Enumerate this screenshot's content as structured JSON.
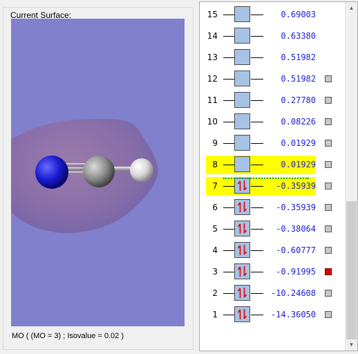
{
  "surface_panel": {
    "title": "Current Surface:",
    "caption": "MO ( (MO = 3) ; Isovalue = 0.02 )"
  },
  "mo_levels": [
    {
      "n": "15",
      "energy": "0.69003",
      "occupied": false,
      "highlight": false,
      "has_square": false
    },
    {
      "n": "14",
      "energy": "0.63380",
      "occupied": false,
      "highlight": false,
      "has_square": false
    },
    {
      "n": "13",
      "energy": "0.51982",
      "occupied": false,
      "highlight": false,
      "has_square": false
    },
    {
      "n": "12",
      "energy": "0.51982",
      "occupied": false,
      "highlight": false,
      "has_square": true,
      "active": false
    },
    {
      "n": "11",
      "energy": "0.27780",
      "occupied": false,
      "highlight": false,
      "has_square": true,
      "active": false
    },
    {
      "n": "10",
      "energy": "0.08226",
      "occupied": false,
      "highlight": false,
      "has_square": true,
      "active": false
    },
    {
      "n": "9",
      "energy": "0.01929",
      "occupied": false,
      "highlight": false,
      "has_square": true,
      "active": false
    },
    {
      "n": "8",
      "energy": "0.01929",
      "occupied": false,
      "highlight": true,
      "has_square": true,
      "active": false
    },
    {
      "n": "7",
      "energy": "-0.35939",
      "occupied": true,
      "highlight": true,
      "has_square": true,
      "active": false
    },
    {
      "n": "6",
      "energy": "-0.35939",
      "occupied": true,
      "highlight": false,
      "has_square": true,
      "active": false
    },
    {
      "n": "5",
      "energy": "-0.38064",
      "occupied": true,
      "highlight": false,
      "has_square": true,
      "active": false
    },
    {
      "n": "4",
      "energy": "-0.60777",
      "occupied": true,
      "highlight": false,
      "has_square": true,
      "active": false
    },
    {
      "n": "3",
      "energy": "-0.91995",
      "occupied": true,
      "highlight": false,
      "has_square": true,
      "active": true
    },
    {
      "n": "2",
      "energy": "-10.24608",
      "occupied": true,
      "highlight": false,
      "has_square": true,
      "active": false
    },
    {
      "n": "1",
      "energy": "-14.36050",
      "occupied": true,
      "highlight": false,
      "has_square": true,
      "active": false
    }
  ],
  "colors": {
    "viewport_background": "#8080cc",
    "orbital_box": "#a6c3e6",
    "highlight": "#ffff00",
    "energy_text": "#1c1ccf",
    "active_square": "#e00000",
    "electron_arrow": "#e00000",
    "nitrogen_atom": "#1a1ad0",
    "carbon_atom": "#8c8c8c",
    "hydrogen_atom": "#e6e6e6"
  },
  "scrollbar": {
    "up_icon": "scroll-up-arrow-icon",
    "down_icon": "scroll-down-arrow-icon",
    "position": 0.57
  }
}
